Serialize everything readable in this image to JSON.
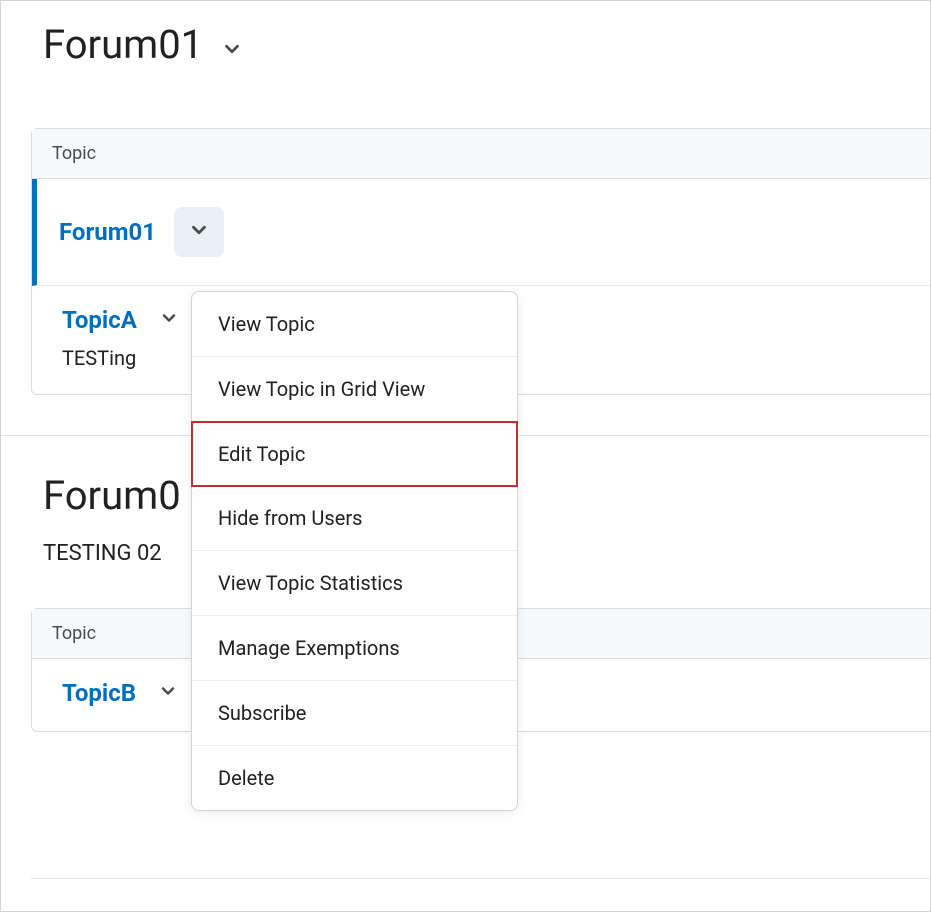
{
  "forum1": {
    "title": "Forum01",
    "tableHeader": "Topic",
    "forumRowLabel": "Forum01",
    "topics": [
      {
        "name": "TopicA",
        "desc": "TESTing"
      }
    ]
  },
  "forum2": {
    "title": "Forum0",
    "subtext": "TESTING 02",
    "tableHeader": "Topic",
    "topics": [
      {
        "name": "TopicB"
      }
    ]
  },
  "dropdown": {
    "items": [
      "View Topic",
      "View Topic in Grid View",
      "Edit Topic",
      "Hide from Users",
      "View Topic Statistics",
      "Manage Exemptions",
      "Subscribe",
      "Delete"
    ],
    "highlightedIndex": 2
  }
}
